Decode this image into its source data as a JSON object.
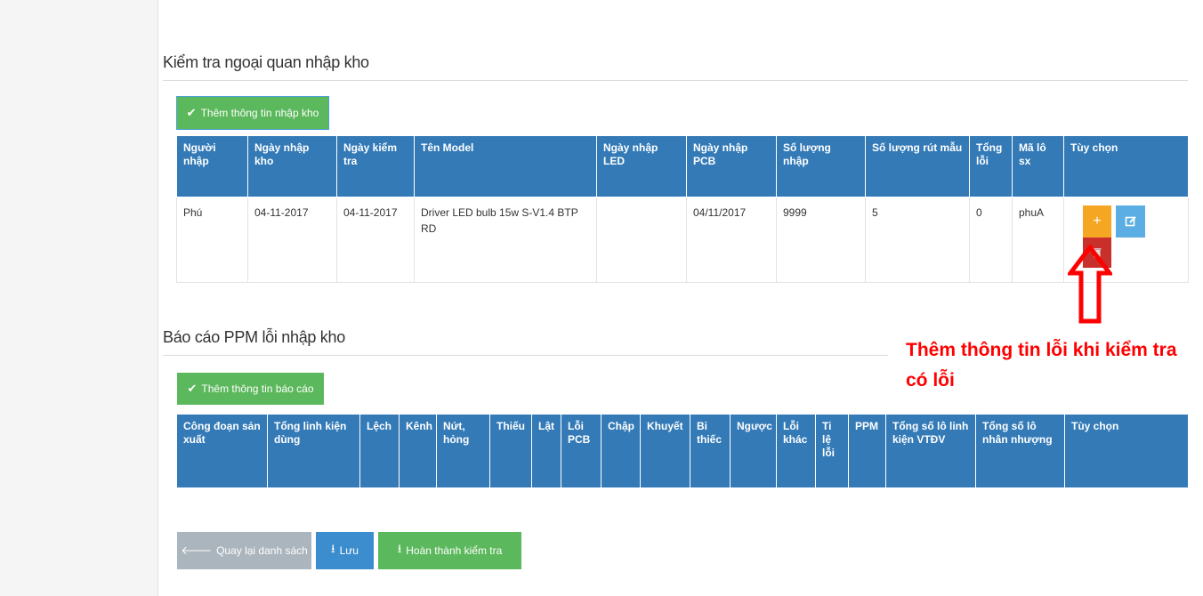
{
  "section1": {
    "title": "Kiểm tra ngoại quan nhập kho",
    "add_button": "Thêm thông tin nhập kho",
    "headers": [
      "Người nhập",
      "Ngày nhập kho",
      "Ngày kiểm tra",
      "Tên Model",
      "Ngày nhập LED",
      "Ngày nhập PCB",
      "Số lượng nhập",
      "Số lượng rút mẫu",
      "Tổng lỗi",
      "Mã lô sx",
      "Tùy chọn"
    ],
    "row": {
      "nguoi_nhap": "Phú",
      "ngay_nhap_kho": "04-11-2017",
      "ngay_kiem_tra": "04-11-2017",
      "ten_model": "Driver LED bulb 15w S-V1.4 BTP RD",
      "ngay_nhap_led": "",
      "ngay_nhap_pcb": "04/11/2017",
      "so_luong_nhap": "9999",
      "so_luong_rut_mau": "5",
      "tong_loi": "0",
      "ma_lo_sx": "phuA",
      "add_icon": "+",
      "edit_icon": "edit-icon",
      "delete_icon": "trash-icon"
    }
  },
  "section2": {
    "title": "Báo cáo PPM lỗi nhập kho",
    "add_button": "Thêm thông tin báo cáo",
    "headers": [
      "Công đoạn sản xuất",
      "Tổng linh kiện dùng",
      "Lệch",
      "Kênh",
      "Nứt, hỏng",
      "Thiếu",
      "Lật",
      "Lỗi PCB",
      "Chập",
      "Khuyết",
      "Bi thiếc",
      "Ngược",
      "Lỗi khác",
      "Ti lệ lỗi",
      "PPM",
      "Tổng số lô linh kiện VTĐV",
      "Tổng số lô nhân nhượng",
      "Tùy chọn"
    ]
  },
  "footer": {
    "back_button": "Quay lại danh sách",
    "save_button": "Lưu",
    "complete_button": "Hoàn thành kiểm tra"
  },
  "annotation": {
    "line1": "Thêm thông tin lỗi khi kiểm tra",
    "line2": "có lỗi",
    "color": "#ff0000"
  },
  "colors": {
    "header_blue": "#337ab7",
    "green": "#5cb85c",
    "orange": "#f5a623",
    "red": "#c9302c",
    "light_blue": "#5aaee3"
  }
}
